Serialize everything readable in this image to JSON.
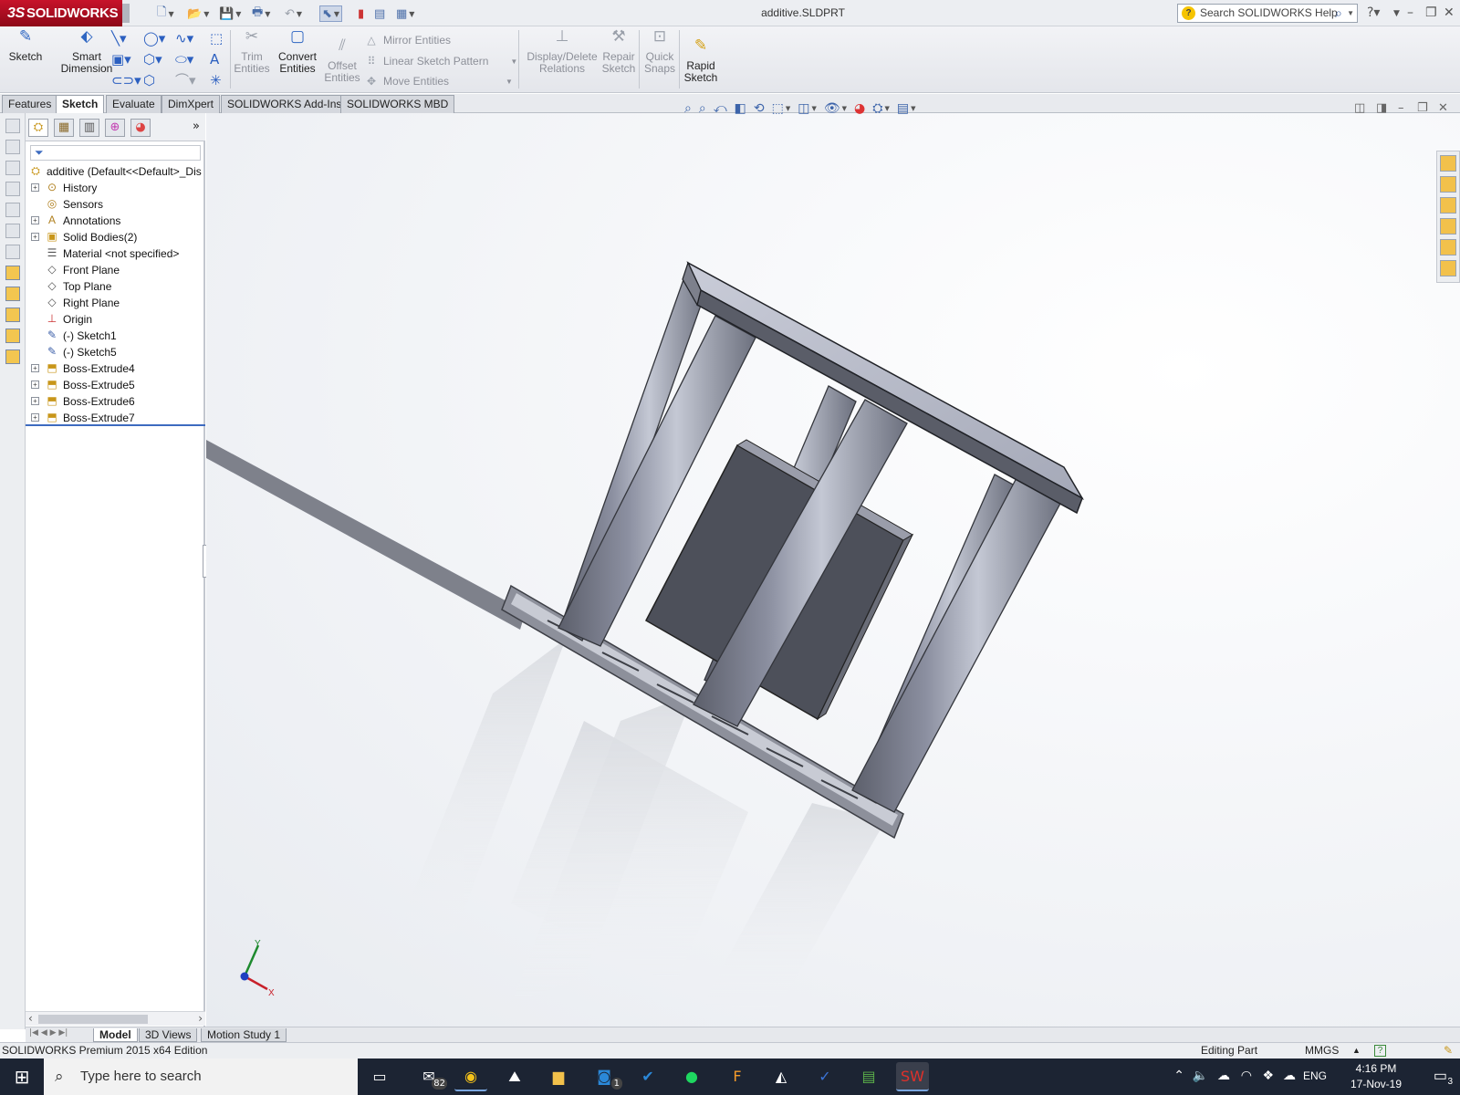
{
  "app": {
    "logo": "SOLIDWORKS",
    "logo_prefix": "3S",
    "document_title": "additive.SLDPRT",
    "search_placeholder": "Search SOLIDWORKS Help"
  },
  "command_manager": {
    "sketch": "Sketch",
    "smart_dimension": [
      "Smart",
      "Dimension"
    ],
    "trim": [
      "Trim",
      "Entities"
    ],
    "convert": [
      "Convert",
      "Entities"
    ],
    "offset": [
      "Offset",
      "Entities"
    ],
    "mirror": "Mirror Entities",
    "linear_pattern": "Linear Sketch Pattern",
    "move": "Move Entities",
    "display_delete": [
      "Display/Delete",
      "Relations"
    ],
    "repair": [
      "Repair",
      "Sketch"
    ],
    "quick_snaps": [
      "Quick",
      "Snaps"
    ],
    "rapid": [
      "Rapid",
      "Sketch"
    ]
  },
  "tabs": [
    "Features",
    "Sketch",
    "Evaluate",
    "DimXpert",
    "SOLIDWORKS Add-Ins",
    "SOLIDWORKS MBD"
  ],
  "active_tab": "Sketch",
  "feature_tree": {
    "root": "additive  (Default<<Default>_Dis",
    "items": [
      {
        "label": "History",
        "expandable": true,
        "icon": "history-icon"
      },
      {
        "label": "Sensors",
        "expandable": false,
        "icon": "sensor-icon"
      },
      {
        "label": "Annotations",
        "expandable": true,
        "icon": "annotation-icon"
      },
      {
        "label": "Solid Bodies(2)",
        "expandable": true,
        "icon": "solid-bodies-icon"
      },
      {
        "label": "Material <not specified>",
        "expandable": false,
        "icon": "material-icon"
      },
      {
        "label": "Front Plane",
        "expandable": false,
        "icon": "plane-icon"
      },
      {
        "label": "Top Plane",
        "expandable": false,
        "icon": "plane-icon"
      },
      {
        "label": "Right Plane",
        "expandable": false,
        "icon": "plane-icon"
      },
      {
        "label": "Origin",
        "expandable": false,
        "icon": "origin-icon"
      },
      {
        "label": "(-) Sketch1",
        "expandable": false,
        "icon": "sketch-icon"
      },
      {
        "label": "(-) Sketch5",
        "expandable": false,
        "icon": "sketch-icon"
      },
      {
        "label": "Boss-Extrude4",
        "expandable": true,
        "icon": "extrude-icon"
      },
      {
        "label": "Boss-Extrude5",
        "expandable": true,
        "icon": "extrude-icon"
      },
      {
        "label": "Boss-Extrude6",
        "expandable": true,
        "icon": "extrude-icon"
      },
      {
        "label": "Boss-Extrude7",
        "expandable": true,
        "icon": "extrude-icon"
      }
    ]
  },
  "triad": {
    "y": "Y",
    "x": "X"
  },
  "bottom_tabs": [
    "Model",
    "3D Views",
    "Motion Study 1"
  ],
  "status": {
    "edition": "SOLIDWORKS Premium 2015 x64 Edition",
    "mode": "Editing Part",
    "units": "MMGS"
  },
  "taskbar": {
    "search_placeholder": "Type here to search",
    "mail_badge": "82",
    "outlook_badge": "1",
    "language": "ENG",
    "time": "4:16 PM",
    "date": "17-Nov-19",
    "notifications": "3"
  },
  "colors": {
    "brand": "#c7132a",
    "accent": "#3d6bc0",
    "taskbar": "#1c2433"
  }
}
